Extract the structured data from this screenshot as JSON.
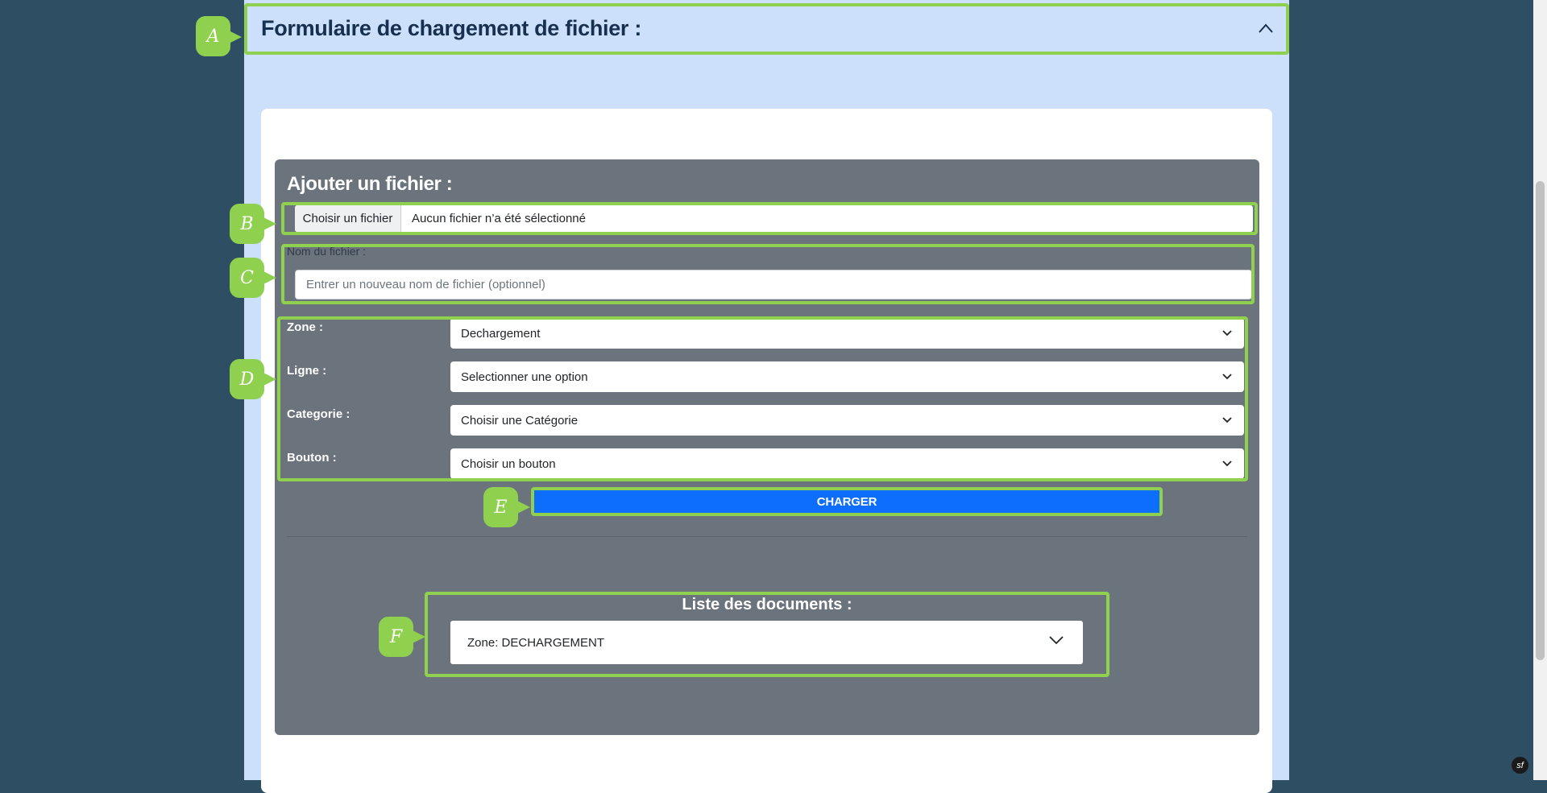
{
  "accordion": {
    "title": "Formulaire de chargement de fichier :",
    "icon": "chevron-up-icon"
  },
  "form": {
    "title": "Ajouter un fichier :",
    "file_button": "Choisir un fichier",
    "file_status": "Aucun fichier n’a été sélectionné",
    "name_label": "Nom du fichier :",
    "name_placeholder": "Entrer un nouveau nom de fichier (optionnel)",
    "selects": [
      {
        "label": "Zone :",
        "value": "Dechargement"
      },
      {
        "label": "Ligne :",
        "value": "Selectionner une option"
      },
      {
        "label": "Categorie :",
        "value": "Choisir une Catégorie"
      },
      {
        "label": "Bouton :",
        "value": "Choisir un bouton"
      }
    ],
    "submit_label": "CHARGER"
  },
  "documents": {
    "title": "Liste des documents :",
    "selected": "Zone: DECHARGEMENT"
  },
  "callouts": [
    "A",
    "B",
    "C",
    "D",
    "E",
    "F"
  ],
  "footer": {
    "symfony_icon": "sf"
  },
  "colors": {
    "page_bg": "#2d4e63",
    "panel_bg": "#cce0fb",
    "form_bg": "#6b737c",
    "highlight": "#8fd14f",
    "primary": "#0d6efd"
  }
}
